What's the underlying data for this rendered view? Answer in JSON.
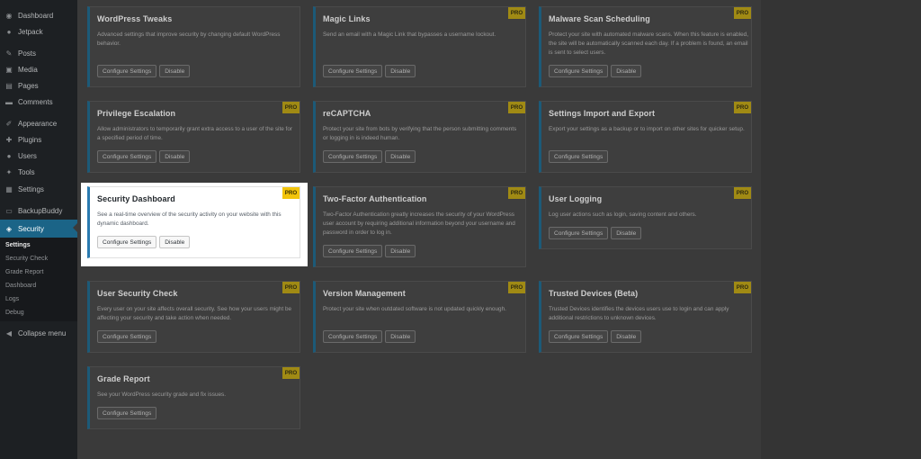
{
  "sidebar": {
    "items": [
      {
        "label": "Dashboard",
        "icon": "dashboard-icon",
        "glyph": "◉"
      },
      {
        "label": "Jetpack",
        "icon": "jetpack-icon",
        "glyph": "●"
      },
      {
        "label": "Posts",
        "icon": "pin-icon",
        "glyph": "✎"
      },
      {
        "label": "Media",
        "icon": "media-icon",
        "glyph": "▣"
      },
      {
        "label": "Pages",
        "icon": "pages-icon",
        "glyph": "▤"
      },
      {
        "label": "Comments",
        "icon": "comments-icon",
        "glyph": "▬"
      },
      {
        "label": "Appearance",
        "icon": "appearance-icon",
        "glyph": "✐"
      },
      {
        "label": "Plugins",
        "icon": "plugins-icon",
        "glyph": "✚"
      },
      {
        "label": "Users",
        "icon": "users-icon",
        "glyph": "●"
      },
      {
        "label": "Tools",
        "icon": "tools-icon",
        "glyph": "✦"
      },
      {
        "label": "Settings",
        "icon": "settings-icon",
        "glyph": "▦"
      },
      {
        "label": "BackupBuddy",
        "icon": "backupbuddy-icon",
        "glyph": "▭"
      },
      {
        "label": "Security",
        "icon": "shield-icon",
        "glyph": "◈"
      }
    ],
    "submenu": [
      "Settings",
      "Security Check",
      "Grade Report",
      "Dashboard",
      "Logs",
      "Debug"
    ],
    "collapse_label": "Collapse menu"
  },
  "modules": [
    {
      "title": "WordPress Tweaks",
      "pro": false,
      "desc": "Advanced settings that improve security by changing default WordPress behavior.",
      "buttons": [
        "Configure Settings",
        "Disable"
      ]
    },
    {
      "title": "Magic Links",
      "pro": true,
      "desc": "Send an email with a Magic Link that bypasses a username lockout.",
      "buttons": [
        "Configure Settings",
        "Disable"
      ]
    },
    {
      "title": "Malware Scan Scheduling",
      "pro": true,
      "desc": "Protect your site with automated malware scans. When this feature is enabled, the site will be automatically scanned each day. If a problem is found, an email is sent to select users.",
      "buttons": [
        "Configure Settings",
        "Disable"
      ]
    },
    {
      "title": "Privilege Escalation",
      "pro": true,
      "desc": "Allow administrators to temporarily grant extra access to a user of the site for a specified period of time.",
      "buttons": [
        "Configure Settings",
        "Disable"
      ]
    },
    {
      "title": "reCAPTCHA",
      "pro": true,
      "desc": "Protect your site from bots by verifying that the person submitting comments or logging in is indeed human.",
      "buttons": [
        "Configure Settings",
        "Disable"
      ]
    },
    {
      "title": "Settings Import and Export",
      "pro": true,
      "desc": "Export your settings as a backup or to import on other sites for quicker setup.",
      "buttons": [
        "Configure Settings"
      ]
    },
    {
      "title": "Security Dashboard",
      "pro": true,
      "desc": "See a real-time overview of the security activity on your website with this dynamic dashboard.",
      "buttons": [
        "Configure Settings",
        "Disable"
      ]
    },
    {
      "title": "Two-Factor Authentication",
      "pro": true,
      "desc": "Two-Factor Authentication greatly increases the security of your WordPress user account by requiring additional information beyond your username and password in order to log in.",
      "buttons": [
        "Configure Settings",
        "Disable"
      ]
    },
    {
      "title": "User Logging",
      "pro": true,
      "desc": "Log user actions such as login, saving content and others.",
      "buttons": [
        "Configure Settings",
        "Disable"
      ]
    },
    {
      "title": "User Security Check",
      "pro": true,
      "desc": "Every user on your site affects overall security. See how your users might be affecting your security and take action when needed.",
      "buttons": [
        "Configure Settings"
      ]
    },
    {
      "title": "Version Management",
      "pro": true,
      "desc": "Protect your site when outdated software is not updated quickly enough.",
      "buttons": [
        "Configure Settings",
        "Disable"
      ]
    },
    {
      "title": "Trusted Devices (Beta)",
      "pro": true,
      "desc": "Trusted Devices identifies the devices users use to login and can apply additional restrictions to unknown devices.",
      "buttons": [
        "Configure Settings",
        "Disable"
      ]
    },
    {
      "title": "Grade Report",
      "pro": true,
      "desc": "See your WordPress security grade and fix issues.",
      "buttons": [
        "Configure Settings"
      ]
    }
  ],
  "pro_label": "PRO",
  "colors": {
    "accent": "#2a7ab0",
    "pro_badge": "#f2c40b",
    "sidebar_active": "#1b6487"
  }
}
